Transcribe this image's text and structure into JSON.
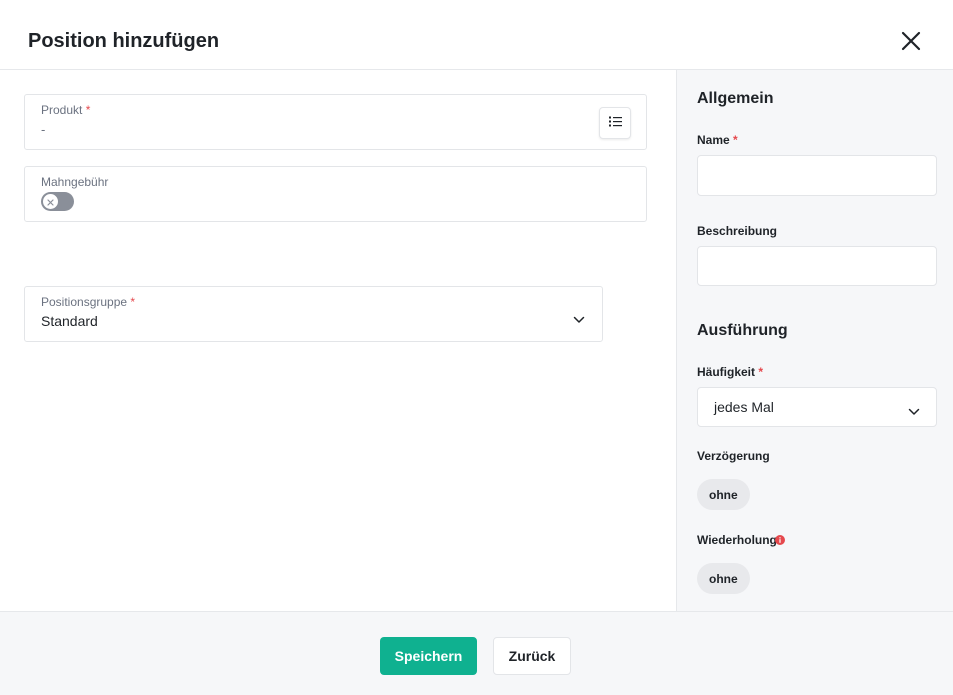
{
  "dialog": {
    "title": "Position hinzufügen",
    "close_icon": "close-icon"
  },
  "form": {
    "produkt": {
      "label": "Produkt",
      "required_mark": "*",
      "value": "-",
      "picker_icon": "list-icon"
    },
    "mahngebuehr": {
      "label": "Mahngebühr",
      "toggle_on": false,
      "toggle_icon": "x-icon"
    },
    "positionsgruppe": {
      "label": "Positionsgruppe",
      "required_mark": "*",
      "value": "Standard",
      "dropdown_icon": "chevron-down-icon"
    }
  },
  "sidebar": {
    "allgemein": {
      "heading": "Allgemein",
      "name": {
        "label": "Name",
        "required_mark": "*",
        "value": ""
      },
      "beschreibung": {
        "label": "Beschreibung",
        "value": ""
      }
    },
    "ausfuehrung": {
      "heading": "Ausführung",
      "haeufigkeit": {
        "label": "Häufigkeit",
        "required_mark": "*",
        "value": "jedes Mal"
      },
      "verzoegerung": {
        "label": "Verzögerung",
        "value": "ohne"
      },
      "wiederholung": {
        "label": "Wiederholung",
        "value": "ohne",
        "info_icon": "info-icon"
      }
    }
  },
  "footer": {
    "save_label": "Speichern",
    "back_label": "Zurück"
  },
  "colors": {
    "primary": "#0fb190",
    "required": "#e5484d",
    "sidebar_bg": "#f6f7f9"
  }
}
